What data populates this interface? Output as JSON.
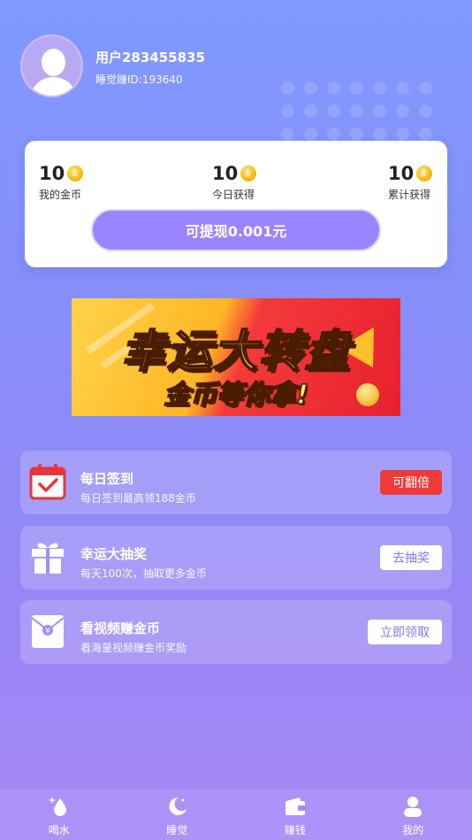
{
  "user": {
    "name": "用户283455835",
    "id": "睡觉赚ID:193640"
  },
  "stats": [
    {
      "value": "10",
      "label": "我的金币"
    },
    {
      "value": "10",
      "label": "今日获得"
    },
    {
      "value": "10",
      "label": "累计获得"
    }
  ],
  "withdraw_label": "可提现0.001元",
  "banner": {
    "title": "幸运大转盘",
    "subtitle": "金币等你拿!"
  },
  "tasks": [
    {
      "title": "每日签到",
      "desc": "每日签到最高领188金币",
      "button": "可翻倍",
      "icon": "calendar-check-icon"
    },
    {
      "title": "幸运大抽奖",
      "desc": "每天100次，抽取更多金币",
      "button": "去抽奖",
      "icon": "gift-icon"
    },
    {
      "title": "看视频赚金币",
      "desc": "看海量视频赚金币奖励",
      "button": "立即领取",
      "icon": "red-envelope-icon"
    }
  ],
  "tabs": [
    {
      "label": "喝水",
      "icon": "water-drop-icon"
    },
    {
      "label": "睡觉",
      "icon": "moon-icon"
    },
    {
      "label": "赚钱",
      "icon": "wallet-icon"
    },
    {
      "label": "我的",
      "icon": "person-icon"
    }
  ],
  "colors": {
    "accent": "#9b84ff",
    "badge_red": "#f03a3a",
    "coin": "#f5b400"
  }
}
